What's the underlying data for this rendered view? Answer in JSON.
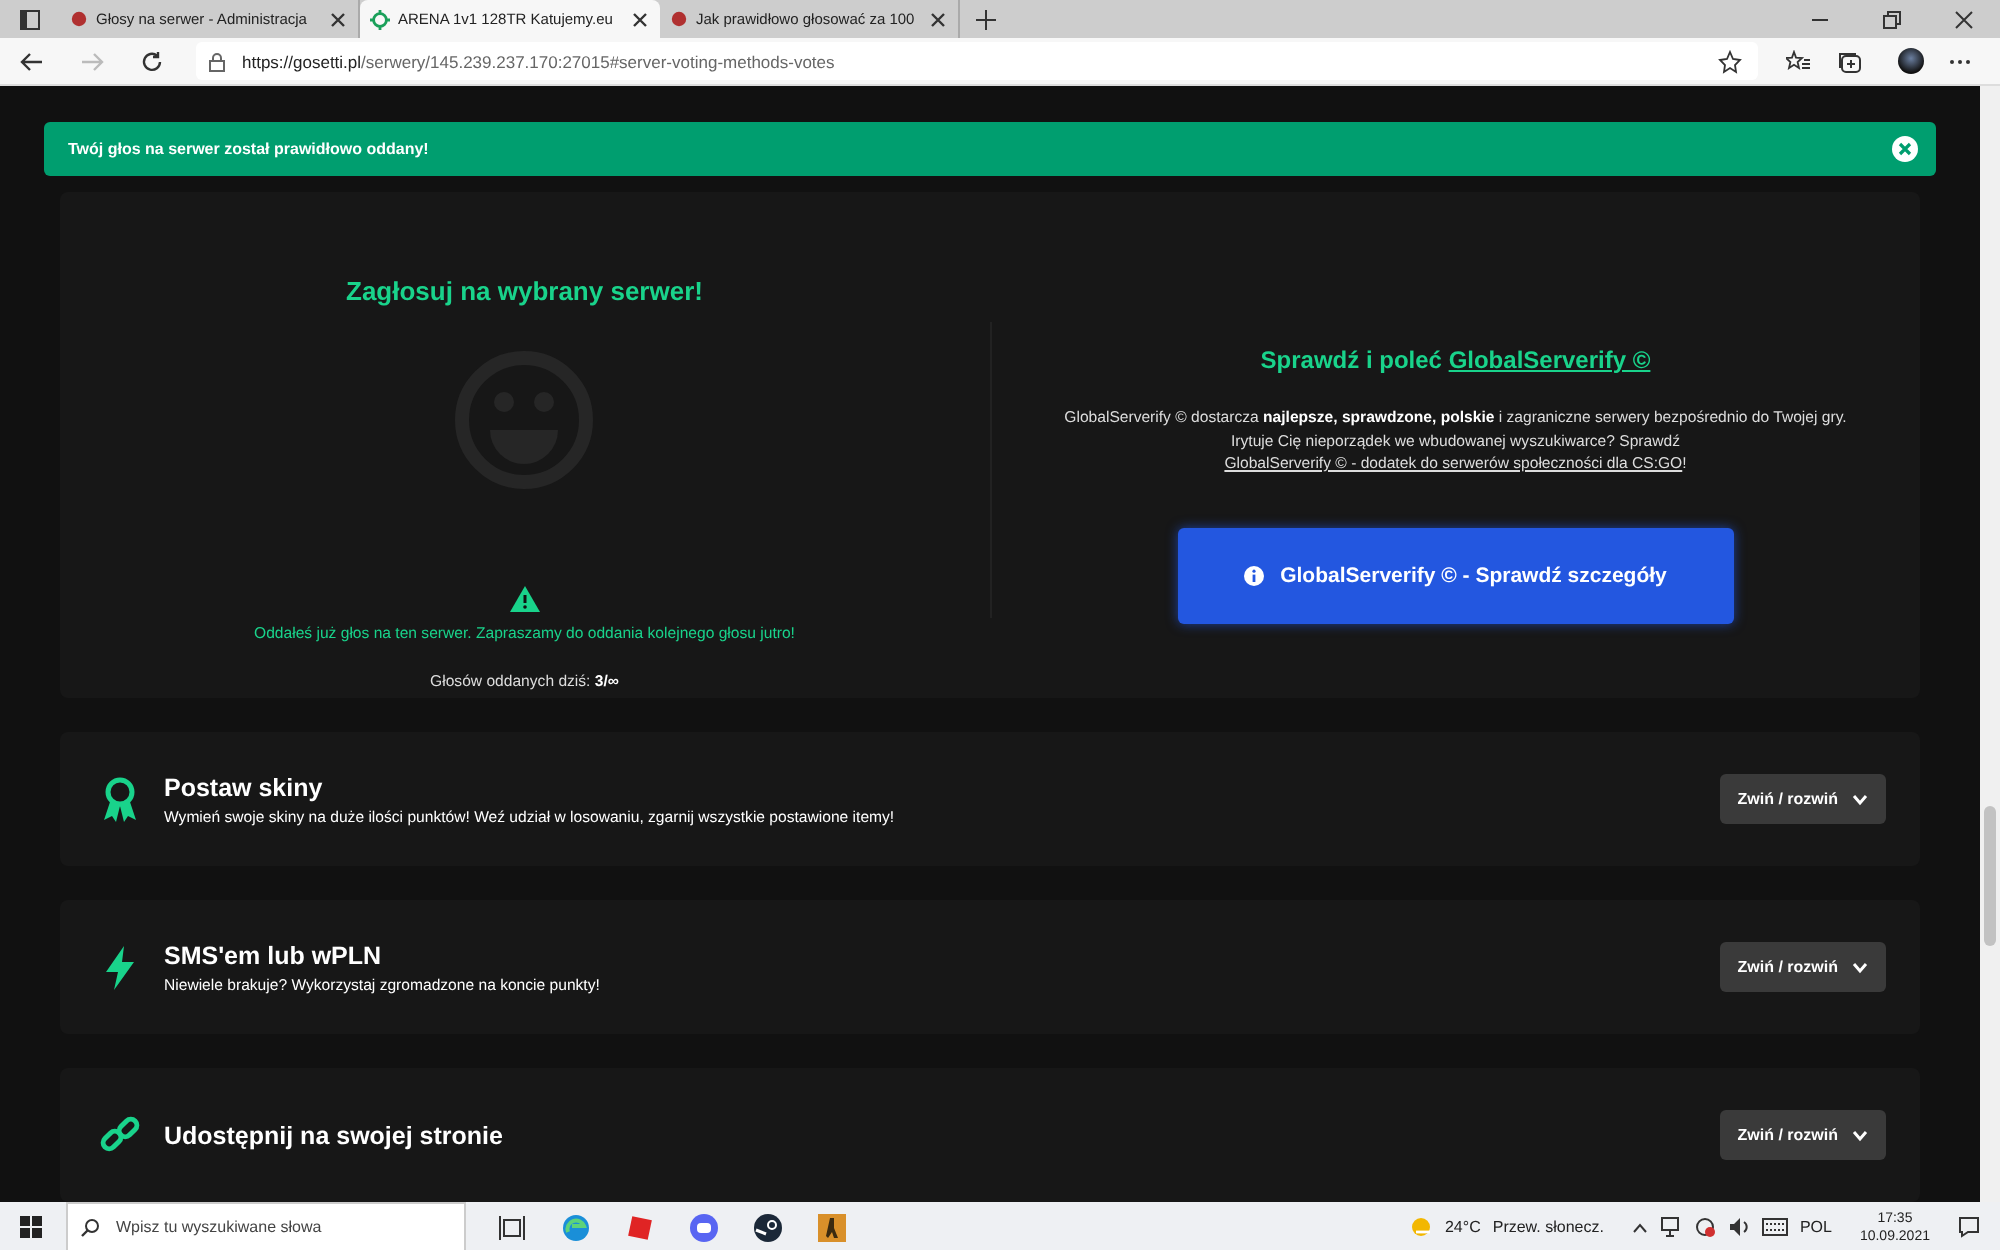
{
  "browser": {
    "tabs": [
      {
        "title": "Głosy na serwer - Administracja",
        "selected": false
      },
      {
        "title": "ARENA 1v1 128TR Katujemy.eu",
        "selected": true
      },
      {
        "title": "Jak prawidłowo głosować za 100",
        "selected": false
      }
    ],
    "url_host": "https://gosetti.pl",
    "url_path": "/serwery/145.239.237.170:27015#server-voting-methods-votes"
  },
  "alert": {
    "text": "Twój głos na serwer został prawidłowo oddany!"
  },
  "vote": {
    "heading": "Zagłosuj na wybrany serwer!",
    "warning": "Oddałeś już głos na ten serwer. Zapraszamy do oddania kolejnego głosu jutro!",
    "count": "Głosów oddanych dziś: **3/∞**"
  },
  "promo": {
    "heading": "Sprawdź i poleć",
    "heading_link": "GlobalServerify ©",
    "text": "GlobalServerify © dostarcza **najlepsze, sprawdzone, polskie** i zagraniczne serwery bezpośrednio do Twojej gry. Irytuje Cię nieporządek we wbudowanej wyszukiwarce? Sprawdź",
    "link": "GlobalServerify © - dodatek do serwerów społeczności dla CS:GO",
    "text_end": "!",
    "button": "GlobalServerify © - Sprawdź szczegóły"
  },
  "sections": [
    {
      "kind": "award",
      "title": "Postaw skiny",
      "description": "Wymień swoje skiny na duże ilości punktów! Weź udział w losowaniu, zgarnij wszystkie postawione itemy!",
      "button": "Zwiń / rozwiń"
    },
    {
      "kind": "bolt",
      "title": "SMS'em lub wPLN",
      "description": "Niewiele brakuje? Wykorzystaj zgromadzone na koncie punkty!",
      "button": "Zwiń / rozwiń"
    },
    {
      "kind": "link",
      "title": "Udostępnij na swojej stronie",
      "button": "Zwiń / rozwiń"
    }
  ],
  "taskbar": {
    "search_placeholder": "Wpisz tu wyszukiwane słowa",
    "temperature": "24°C",
    "weather": "Przew. słonecz.",
    "language": "POL",
    "time": "17:35",
    "date": "10.09.2021"
  }
}
